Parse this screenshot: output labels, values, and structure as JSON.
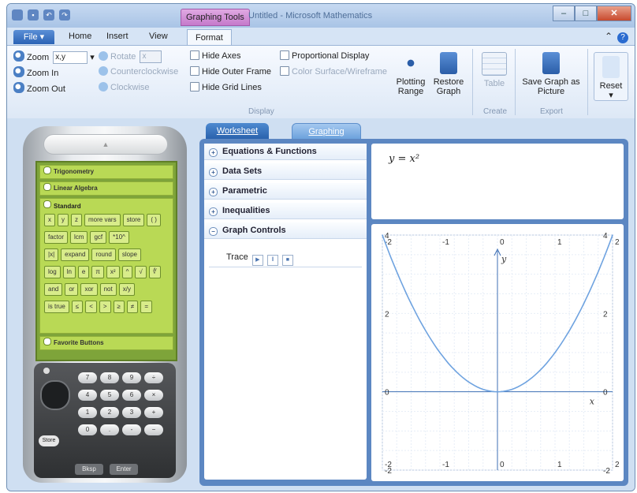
{
  "titlebar": {
    "context_tab": "Graphing Tools",
    "title": "Untitled - Microsoft Mathematics"
  },
  "ribbon_tabs": [
    "File",
    "Home",
    "Insert",
    "View",
    "Format"
  ],
  "ribbon": {
    "zoom_label": "Zoom",
    "zoom_value": "x,y",
    "zoom_in": "Zoom In",
    "zoom_out": "Zoom Out",
    "rotate_label": "Rotate",
    "rotate_value": "x",
    "counterclockwise": "Counterclockwise",
    "clockwise": "Clockwise",
    "hide_axes": "Hide Axes",
    "hide_outer_frame": "Hide Outer Frame",
    "hide_grid_lines": "Hide Grid Lines",
    "proportional_display": "Proportional Display",
    "color_surface": "Color Surface/Wireframe",
    "display_group": "Display",
    "plotting_range": "Plotting Range",
    "restore_graph": "Restore Graph",
    "table": "Table",
    "create_group": "Create",
    "save_graph": "Save Graph as Picture",
    "export_group": "Export",
    "reset": "Reset"
  },
  "calculator": {
    "sections": [
      "Trigonometry",
      "Linear Algebra",
      "Standard",
      "Favorite Buttons"
    ],
    "rows": [
      [
        "x",
        "y",
        "z",
        "more vars",
        "store",
        "( )"
      ],
      [
        "factor",
        "lcm",
        "gcf",
        "*10^"
      ],
      [
        "|x|",
        "expand",
        "round",
        "slope"
      ],
      [
        "log",
        "ln",
        "e",
        "π",
        "x²",
        "^",
        "√",
        "∜"
      ],
      [
        "and",
        "or",
        "xor",
        "not",
        "x/y"
      ],
      [
        "is true",
        "≤",
        "<",
        ">",
        "≥",
        "≠",
        "="
      ]
    ],
    "keypad": [
      "7",
      "8",
      "9",
      "÷",
      "4",
      "5",
      "6",
      "×",
      "1",
      "2",
      "3",
      "+",
      "0",
      ".",
      "-",
      "−"
    ],
    "store_key": "Store",
    "bksp_key": "Bksp",
    "enter_key": "Enter"
  },
  "worksheet_tab": "Worksheet",
  "graphing_tab": "Graphing",
  "accordion": [
    "Equations & Functions",
    "Data Sets",
    "Parametric",
    "Inequalities",
    "Graph Controls"
  ],
  "trace_label": "Trace",
  "equation": "y = x²",
  "chart_data": {
    "type": "line",
    "series": [
      {
        "x": [
          -2,
          -1.5,
          -1,
          -0.5,
          0,
          0.5,
          1,
          1.5,
          2
        ],
        "y": [
          4,
          2.25,
          1,
          0.25,
          0,
          0.25,
          1,
          2.25,
          4
        ]
      }
    ],
    "xlim": [
      -2,
      2
    ],
    "ylim": [
      -2,
      4
    ],
    "x_ticks": [
      "-2",
      "-1",
      "0",
      "1",
      "2"
    ],
    "y_ticks": [
      "-2",
      "0",
      "2",
      "4"
    ],
    "xlabel": "x",
    "ylabel": "y",
    "grid": true
  }
}
